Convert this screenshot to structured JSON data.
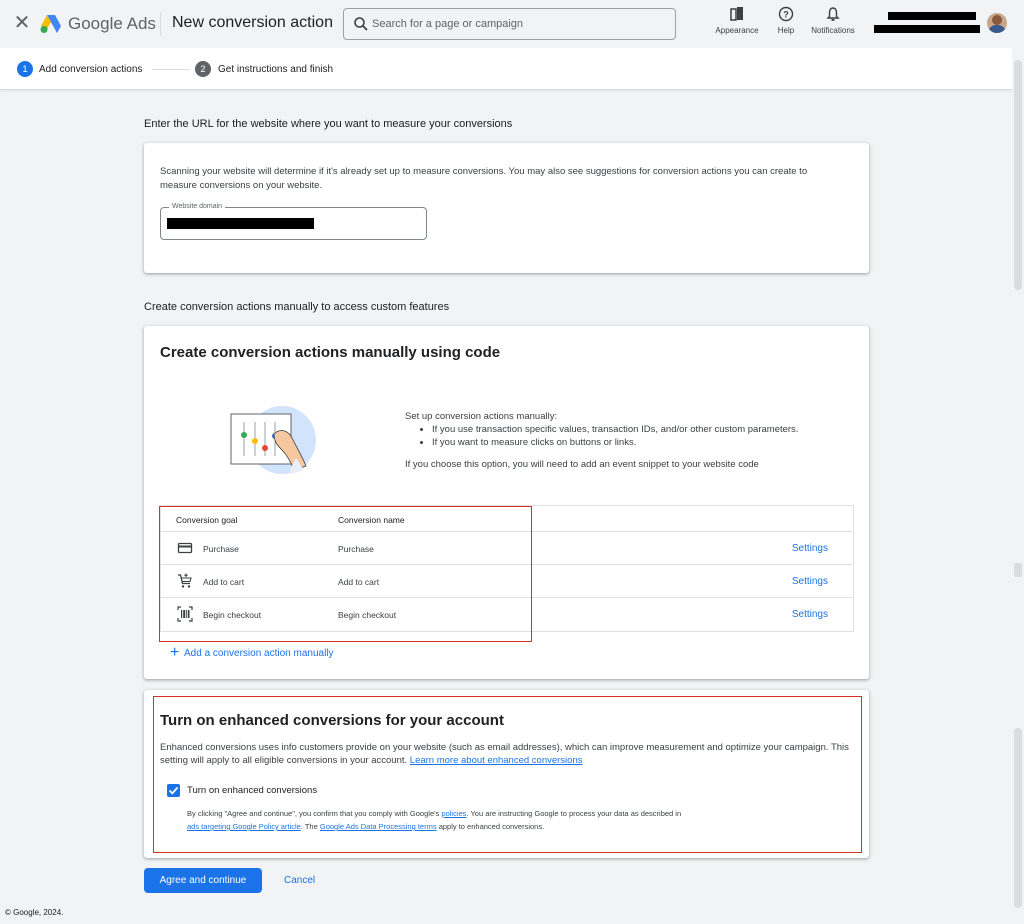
{
  "header": {
    "brand": "Google Ads",
    "title": "New conversion action",
    "search_placeholder": "Search for a page or campaign",
    "appearance": "Appearance",
    "help": "Help",
    "notifications": "Notifications"
  },
  "stepper": {
    "steps": [
      {
        "number": "1",
        "label": "Add conversion actions",
        "active": true
      },
      {
        "number": "2",
        "label": "Get instructions and finish",
        "active": false
      }
    ]
  },
  "url_section": {
    "heading": "Enter the URL for the website where you want to measure your conversions",
    "description": "Scanning your website will determine if it's already set up to measure conversions. You may also see suggestions for conversion actions you can create to measure conversions on your website.",
    "field_label": "Website domain"
  },
  "manual_section": {
    "heading": "Create conversion actions manually to access custom features",
    "title": "Create conversion actions manually using code",
    "intro": "Set up conversion actions manually:",
    "bullets": [
      "If you use transaction specific values, transaction IDs, and/or other custom parameters.",
      "If you want to measure clicks on buttons or links."
    ],
    "note": "If you choose this option, you will need to add an event snippet to your website code",
    "table": {
      "col_goal": "Conversion goal",
      "col_name": "Conversion name",
      "rows": [
        {
          "icon": "credit-card-icon",
          "goal": "Purchase",
          "name": "Purchase",
          "action": "Settings"
        },
        {
          "icon": "cart-add-icon",
          "goal": "Add to cart",
          "name": "Add to cart",
          "action": "Settings"
        },
        {
          "icon": "barcode-icon",
          "goal": "Begin checkout",
          "name": "Begin checkout",
          "action": "Settings"
        }
      ]
    },
    "add_link": "Add a conversion action manually"
  },
  "enhanced_section": {
    "title": "Turn on enhanced conversions for your account",
    "text": "Enhanced conversions uses info customers provide on your website (such as email addresses), which can improve measurement and optimize your campaign. This setting will apply to all eligible conversions in your account.",
    "learn_more": "Learn more about enhanced conversions",
    "checkbox_label": "Turn on enhanced conversions",
    "checkbox_checked": true,
    "fine_1": "By clicking \"Agree and continue\", you confirm that you comply with Google's",
    "fine_link_1": "policies",
    "fine_2": ". You are instructing Google to process your data as described in",
    "fine_link_2": "ads targeting Google Policy article",
    "fine_3": ". The",
    "fine_link_3": "Google Ads Data Processing terms",
    "fine_4": "apply to enhanced conversions."
  },
  "actions": {
    "primary": "Agree and continue",
    "cancel": "Cancel"
  },
  "footer": "© Google, 2024.",
  "colors": {
    "accent": "#1a73e8",
    "highlight_border": "#d93025",
    "step_inactive": "#5f6368"
  }
}
